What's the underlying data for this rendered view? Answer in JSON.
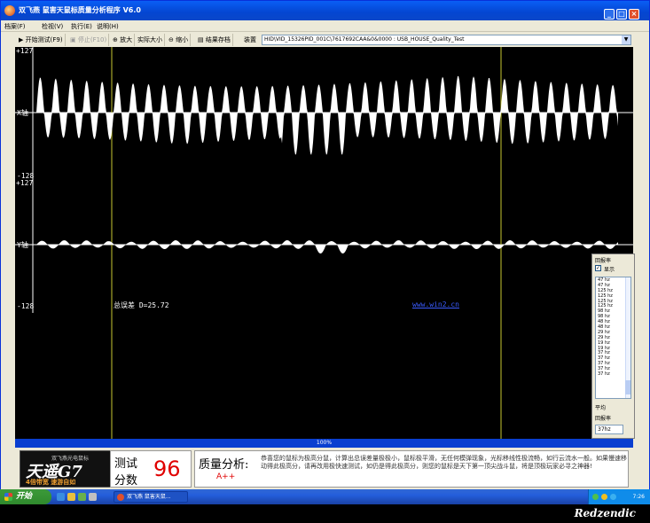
{
  "window": {
    "title": "双飞燕  鼠害天鼠标质量分析程序  V6.0",
    "buttons": {
      "minimize": "_",
      "maximize": "□",
      "close": "×"
    }
  },
  "menu": [
    "档案(F)",
    "检视(V)",
    "执行(E)",
    "说明(H)"
  ],
  "toolbar": {
    "start_test": "开始测试(F9)",
    "stop": "停止(F10)",
    "zoom_in": "放大",
    "actual_size": "实际大小",
    "zoom_out": "缩小",
    "save_result": "结果存档",
    "device_label": "装置",
    "device_value": "HID\\VID_15326PID_001C\\7617692CAA&0&0000  :  USB_HOUSE_Quality_Test"
  },
  "scope": {
    "x_axis": {
      "max": "+127",
      "label": "X轴",
      "min": "-128"
    },
    "y_axis": {
      "max": "+127",
      "label": "Y轴",
      "min": "-128"
    },
    "total_error": "总误差  D=25.72",
    "link": "www.win2.cn"
  },
  "rate_panel": {
    "title": "回报率",
    "show_label": "显示",
    "show_checked": true,
    "items": [
      "47 hz",
      "47 hz",
      "125 hz",
      "125 hz",
      "125 hz",
      "125 hz",
      "98 hz",
      "98 hz",
      "48 hz",
      "48 hz",
      "29 hz",
      "29 hz",
      "19 hz",
      "19 hz",
      "37 hz",
      "37 hz",
      "37 hz",
      "37 hz",
      "37 hz"
    ],
    "avg_label_1": "平均",
    "avg_label_2": "回报率",
    "avg_value": "37hz"
  },
  "progress": {
    "percent": 100,
    "label": "100%"
  },
  "bottom": {
    "logo_small": "双飞燕光电鼠标",
    "logo_big": "天遥G7",
    "logo_sub": "4倍带宽 速游自如",
    "score_label_1": "测试",
    "score_label_2": "分数",
    "score": "96",
    "quality_label": "质量分析:",
    "grade": "A++",
    "quality_text": "恭喜您的鼠标为极高分鼠，计算出总误差量极极小，鼠标极平滑，无任何模弹现象，光标移线性极流畅，如行云流水一般。如果慢速移动得此极高分，请再改用极快速测试，如仍是得此极高分，则您的鼠标是天下第一顶尖战斗鼠，将是顶极玩家必寻之神器!"
  },
  "taskbar": {
    "start": "开始",
    "task_button": "双飞燕  鼠害天鼠...",
    "clock": "7:26"
  },
  "watermark": "Redzendic"
}
